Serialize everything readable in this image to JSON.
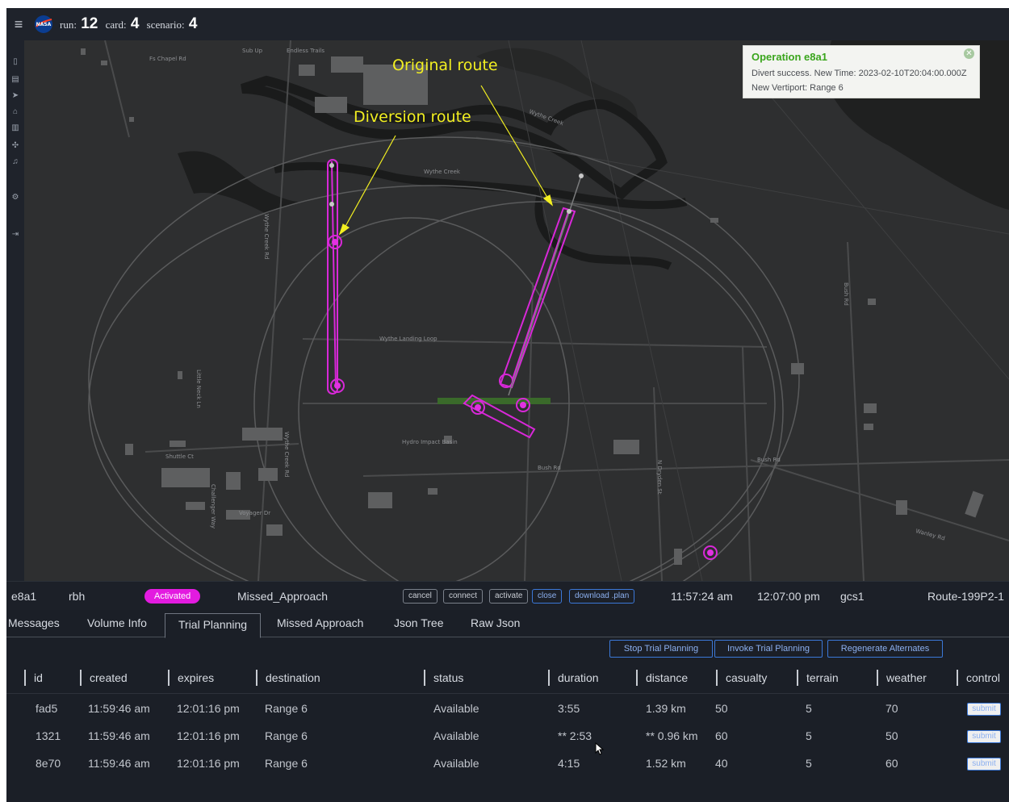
{
  "header": {
    "run_label": "run:",
    "run_value": "12",
    "card_label": "card:",
    "card_value": "4",
    "scenario_label": "scenario:",
    "scenario_value": "4"
  },
  "map": {
    "annotations": {
      "original_route": "Original route",
      "diversion_route": "Diversion route"
    },
    "labels": {
      "fs_chapel_rd": "Fs Chapel Rd",
      "sub_up": "Sub Up",
      "endless_trails": "Endless Trails",
      "wythe_creek": "Wythe Creek",
      "wythe_creek_2": "Wythe Creek",
      "wythe_creek_rd": "Wythe Creek Rd",
      "wythe_creek_rd_2": "Wythe Creek Rd",
      "wythe_landing_loop": "Wythe Landing Loop",
      "little_neck_ln": "Little Neck Ln",
      "shuttle_ct": "Shuttle Ct",
      "challenger_way": "Challenger Way",
      "voyager_dr": "Voyager Dr",
      "hydro_impact_basin": "Hydro Impact Basin",
      "bush_rd": "Bush Rd",
      "bush_rd_2": "Bush Rd",
      "bush_rd_3": "Bush Rd",
      "n_dryden_st": "N Dryden St",
      "wanley_rd": "Wanley Rd"
    },
    "route_color": "#d828d8"
  },
  "notification": {
    "title": "Operation e8a1",
    "text": "Divert success. New Time: 2023-02-10T20:04:00.000Z New Vertiport: Range 6"
  },
  "operation": {
    "id": "e8a1",
    "owner": "rbh",
    "status": "Activated",
    "phase": "Missed_Approach",
    "buttons": [
      "cancel",
      "connect",
      "activate",
      "close",
      "download .plan"
    ],
    "start_time": "11:57:24 am",
    "end_time": "12:07:00 pm",
    "gcs": "gcs1",
    "route": "Route-199P2-1"
  },
  "tabs": [
    "Messages",
    "Volume Info",
    "Trial Planning",
    "Missed Approach",
    "Json Tree",
    "Raw Json"
  ],
  "actions": {
    "stop": "Stop Trial Planning",
    "invoke": "Invoke Trial Planning",
    "regenerate": "Regenerate Alternates"
  },
  "table": {
    "columns": [
      "id",
      "created",
      "expires",
      "destination",
      "status",
      "duration",
      "distance",
      "casualty",
      "terrain",
      "weather",
      "control"
    ],
    "rows": [
      {
        "id": "fad5",
        "created": "11:59:46 am",
        "expires": "12:01:16 pm",
        "destination": "Range 6",
        "status": "Available",
        "duration": "3:55",
        "distance": "1.39 km",
        "casualty": "50",
        "terrain": "5",
        "weather": "70",
        "control": "submit"
      },
      {
        "id": "1321",
        "created": "11:59:46 am",
        "expires": "12:01:16 pm",
        "destination": "Range 6",
        "status": "Available",
        "duration": "** 2:53",
        "distance": "** 0.96 km",
        "casualty": "60",
        "terrain": "5",
        "weather": "50",
        "control": "submit"
      },
      {
        "id": "8e70",
        "created": "11:59:46 am",
        "expires": "12:01:16 pm",
        "destination": "Range 6",
        "status": "Available",
        "duration": "4:15",
        "distance": "1.52 km",
        "casualty": "40",
        "terrain": "5",
        "weather": "60",
        "control": "submit"
      }
    ]
  }
}
